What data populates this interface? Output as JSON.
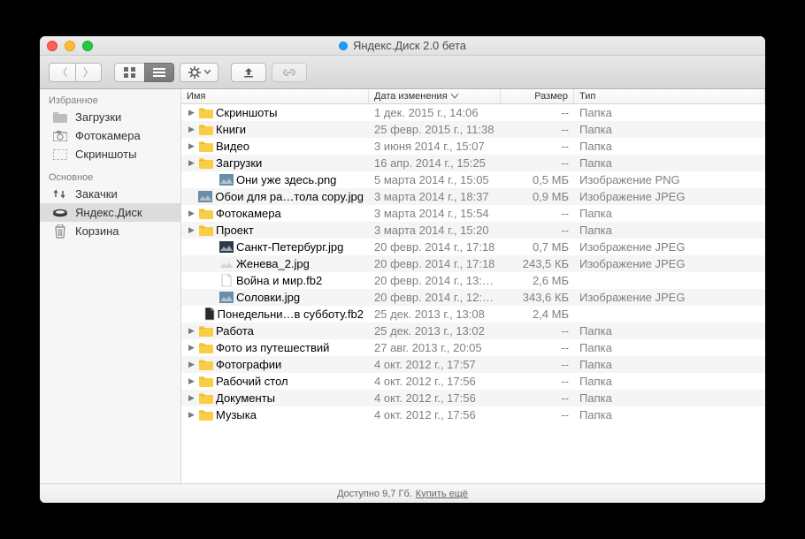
{
  "window": {
    "title": "Яндекс.Диск 2.0 бета"
  },
  "columns": {
    "name": "Имя",
    "date": "Дата изменения",
    "size": "Размер",
    "kind": "Тип"
  },
  "sidebar": {
    "favorites_header": "Избранное",
    "favorites": [
      {
        "label": "Загрузки",
        "icon": "folder"
      },
      {
        "label": "Фотокамера",
        "icon": "camera"
      },
      {
        "label": "Скриншоты",
        "icon": "screenshots"
      }
    ],
    "main_header": "Основное",
    "main": [
      {
        "label": "Закачки",
        "icon": "transfers",
        "selected": false
      },
      {
        "label": "Яндекс.Диск",
        "icon": "disk",
        "selected": true
      },
      {
        "label": "Корзина",
        "icon": "trash",
        "selected": false
      }
    ]
  },
  "footer": {
    "text": "Доступно 9,7 Гб.",
    "link": "Купить ещё"
  },
  "files": [
    {
      "name": "Скриншоты",
      "date": "1 дек. 2015 г., 14:06",
      "size": "--",
      "kind": "Папка",
      "type": "folder",
      "indent": 0,
      "disc": true
    },
    {
      "name": "Книги",
      "date": "25 февр. 2015 г., 11:38",
      "size": "--",
      "kind": "Папка",
      "type": "folder",
      "indent": 0,
      "disc": true
    },
    {
      "name": "Видео",
      "date": "3 июня 2014 г., 15:07",
      "size": "--",
      "kind": "Папка",
      "type": "folder",
      "indent": 0,
      "disc": true
    },
    {
      "name": "Загрузки",
      "date": "16 апр. 2014 г., 15:25",
      "size": "--",
      "kind": "Папка",
      "type": "folder",
      "indent": 0,
      "disc": true
    },
    {
      "name": "Они уже здесь.png",
      "date": "5 марта 2014 г., 15:05",
      "size": "0,5 МБ",
      "kind": "Изображение PNG",
      "type": "image",
      "indent": 1,
      "disc": false
    },
    {
      "name": "Обои для ра…тола copy.jpg",
      "date": "3 марта 2014 г., 18:37",
      "size": "0,9 МБ",
      "kind": "Изображение JPEG",
      "type": "image",
      "indent": 1,
      "disc": false
    },
    {
      "name": "Фотокамера",
      "date": "3 марта 2014 г., 15:54",
      "size": "--",
      "kind": "Папка",
      "type": "folder",
      "indent": 0,
      "disc": true
    },
    {
      "name": "Проект",
      "date": "3 марта 2014 г., 15:20",
      "size": "--",
      "kind": "Папка",
      "type": "folder",
      "indent": 0,
      "disc": true
    },
    {
      "name": "Санкт-Петербург.jpg",
      "date": "20 февр. 2014 г., 17:18",
      "size": "0,7 МБ",
      "kind": "Изображение JPEG",
      "type": "image-dark",
      "indent": 1,
      "disc": false
    },
    {
      "name": "Женева_2.jpg",
      "date": "20 февр. 2014 г., 17:18",
      "size": "243,5 КБ",
      "kind": "Изображение JPEG",
      "type": "image-light",
      "indent": 1,
      "disc": false
    },
    {
      "name": "Война и мир.fb2",
      "date": "20 февр. 2014 г., 13:…",
      "size": "2,6 МБ",
      "kind": "",
      "type": "doc",
      "indent": 1,
      "disc": false
    },
    {
      "name": "Соловки.jpg",
      "date": "20 февр. 2014 г., 12:…",
      "size": "343,6 КБ",
      "kind": "Изображение JPEG",
      "type": "image",
      "indent": 1,
      "disc": false
    },
    {
      "name": "Понедельни…в субботу.fb2",
      "date": "25 дек. 2013 г., 13:08",
      "size": "2,4 МБ",
      "kind": "",
      "type": "doc-dark",
      "indent": 1,
      "disc": false
    },
    {
      "name": "Работа",
      "date": "25 дек. 2013 г., 13:02",
      "size": "--",
      "kind": "Папка",
      "type": "folder",
      "indent": 0,
      "disc": true
    },
    {
      "name": "Фото из путешествий",
      "date": "27 авг. 2013 г., 20:05",
      "size": "--",
      "kind": "Папка",
      "type": "folder",
      "indent": 0,
      "disc": true
    },
    {
      "name": "Фотографии",
      "date": "4 окт. 2012 г., 17:57",
      "size": "--",
      "kind": "Папка",
      "type": "folder",
      "indent": 0,
      "disc": true
    },
    {
      "name": "Рабочий стол",
      "date": "4 окт. 2012 г., 17:56",
      "size": "--",
      "kind": "Папка",
      "type": "folder",
      "indent": 0,
      "disc": true
    },
    {
      "name": "Документы",
      "date": "4 окт. 2012 г., 17:56",
      "size": "--",
      "kind": "Папка",
      "type": "folder",
      "indent": 0,
      "disc": true
    },
    {
      "name": "Музыка",
      "date": "4 окт. 2012 г., 17:56",
      "size": "--",
      "kind": "Папка",
      "type": "folder",
      "indent": 0,
      "disc": true
    }
  ]
}
